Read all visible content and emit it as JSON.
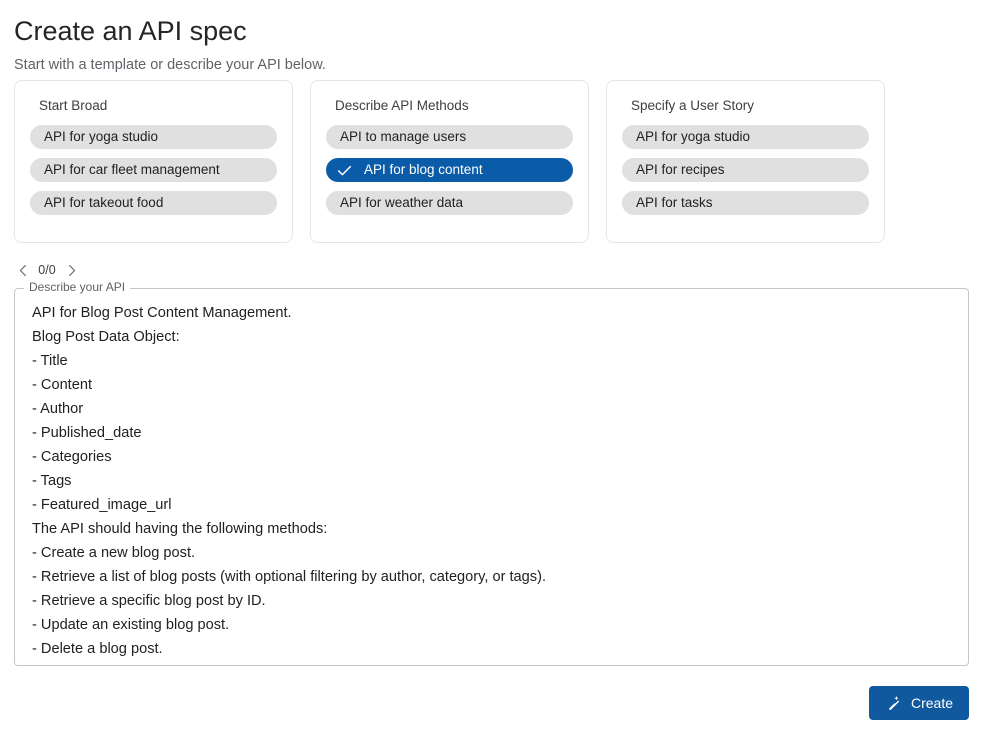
{
  "header": {
    "title": "Create an API spec",
    "subtitle": "Start with a template or describe your API below."
  },
  "templates": {
    "cards": [
      {
        "title": "Start Broad",
        "chips": [
          {
            "label": "API for yoga studio",
            "selected": false
          },
          {
            "label": "API for car fleet management",
            "selected": false
          },
          {
            "label": "API for takeout food",
            "selected": false
          }
        ]
      },
      {
        "title": "Describe API Methods",
        "chips": [
          {
            "label": "API to manage users",
            "selected": false
          },
          {
            "label": "API for blog content",
            "selected": true
          },
          {
            "label": "API for weather data",
            "selected": false
          }
        ]
      },
      {
        "title": "Specify a User Story",
        "chips": [
          {
            "label": "API for yoga studio",
            "selected": false
          },
          {
            "label": "API for recipes",
            "selected": false
          },
          {
            "label": "API for tasks",
            "selected": false
          }
        ]
      }
    ]
  },
  "pager": {
    "prev_icon": "chevron-left-icon",
    "next_icon": "chevron-right-icon",
    "count": "0/0"
  },
  "describe": {
    "legend": "Describe your API",
    "placeholder": "Describe your API",
    "value": "API for Blog Post Content Management.\nBlog Post Data Object:\n- Title\n- Content\n- Author\n- Published_date\n- Categories\n- Tags\n- Featured_image_url\nThe API should having the following methods:\n- Create a new blog post.\n- Retrieve a list of blog posts (with optional filtering by author, category, or tags).\n- Retrieve a specific blog post by ID.\n- Update an existing blog post.\n- Delete a blog post."
  },
  "actions": {
    "create_label": "Create",
    "create_icon": "magic-wand-icon"
  },
  "colors": {
    "accent_blue": "#10599f",
    "chip_selected_blue": "#0b5ca8",
    "chip_gray": "#e0e0e0",
    "text_primary": "#202124",
    "text_secondary": "#5f6368",
    "card_border": "#e4e5e7",
    "field_border": "#c4c7c5"
  }
}
